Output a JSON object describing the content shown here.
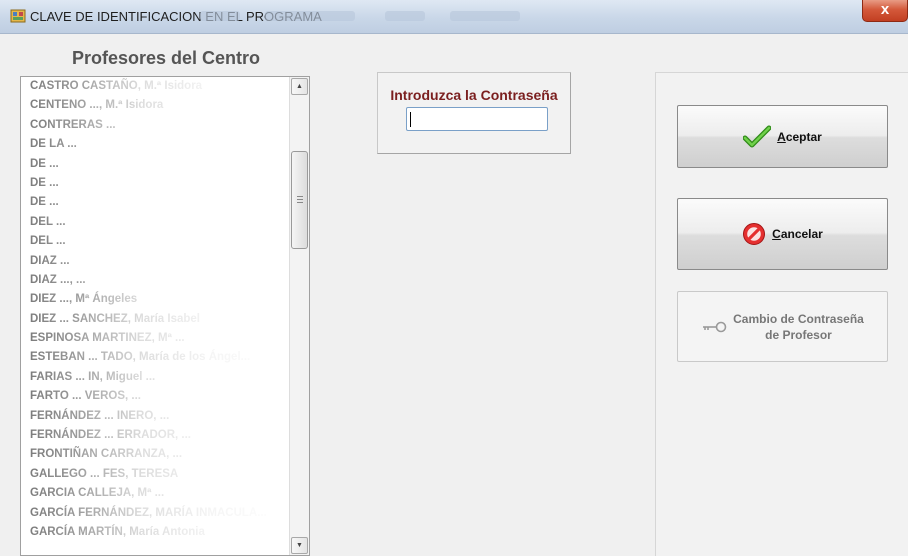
{
  "window": {
    "title": "CLAVE DE IDENTIFICACION EN EL PROGRAMA",
    "close_label": "x"
  },
  "teachers": {
    "heading": "Profesores del Centro",
    "items": [
      "CASTRO CASTAÑO, M.ª Isidora",
      "CENTENO ..., M.ª Isidora",
      "CONTRERAS ...",
      "DE LA ...",
      "DE ...",
      "DE ...",
      "DE ...",
      "DEL ...",
      "DEL ...",
      "DIAZ ...",
      "DIAZ ..., ...",
      "DIEZ ..., Mª Ángeles",
      "DIEZ ... SANCHEZ, María Isabel",
      "ESPINOSA MARTINEZ, Mª ...",
      "ESTEBAN ... TADO, María de los Ángel...",
      "FARIAS ... IN, Miguel ...",
      "FARTO ... VEROS, ...",
      "FERNÁNDEZ ... INERO, ...",
      "FERNÁNDEZ ... ERRADOR, ...",
      "FRONTIÑAN CARRANZA, ...",
      "GALLEGO ... FES, TERESA",
      "GARCIA CALLEJA, Mª ...",
      "GARCÍA FERNÁNDEZ, MARÍA INMACULA...",
      "GARCÍA MARTÍN, María Antonia"
    ]
  },
  "password": {
    "label": "Introduzca la Contraseña",
    "value": ""
  },
  "buttons": {
    "accept": {
      "mnemonic": "A",
      "rest": "ceptar"
    },
    "cancel": {
      "mnemonic": "C",
      "rest": "ancelar"
    },
    "change_line1": "Cambio de Contraseña",
    "change_line2": "de Profesor"
  },
  "colors": {
    "label_dark_red": "#7b1f1f",
    "accept_green": "#3a9a1a",
    "cancel_red": "#d81e1e"
  }
}
